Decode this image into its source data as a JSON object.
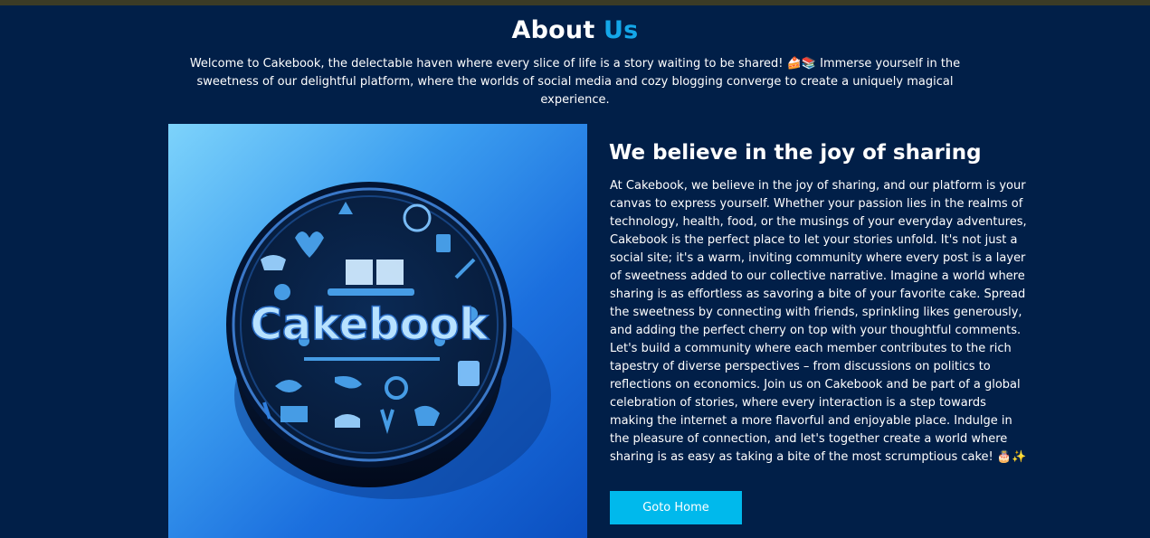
{
  "header": {
    "title_part1": "About",
    "title_part2": "Us",
    "intro": "Welcome to Cakebook, the delectable haven where every slice of life is a story waiting to be shared! 🍰📚 Immerse yourself in the sweetness of our delightful platform, where the worlds of social media and cozy blogging converge to create a uniquely magical experience."
  },
  "hero": {
    "logo_text": "Cakebook"
  },
  "section": {
    "heading": "We believe in the joy of sharing",
    "body": "At Cakebook, we believe in the joy of sharing, and our platform is your canvas to express yourself. Whether your passion lies in the realms of technology, health, food, or the musings of your everyday adventures, Cakebook is the perfect place to let your stories unfold. It's not just a social site; it's a warm, inviting community where every post is a layer of sweetness added to our collective narrative. Imagine a world where sharing is as effortless as savoring a bite of your favorite cake. Spread the sweetness by connecting with friends, sprinkling likes generously, and adding the perfect cherry on top with your thoughtful comments. Let's build a community where each member contributes to the rich tapestry of diverse perspectives – from discussions on politics to reflections on economics. Join us on Cakebook and be part of a global celebration of stories, where every interaction is a step towards making the internet a more flavorful and enjoyable place. Indulge in the pleasure of connection, and let's together create a world where sharing is as easy as taking a bite of the most scrumptious cake! 🎂✨",
    "button_label": "Goto Home"
  },
  "colors": {
    "background": "#011f48",
    "accent": "#14a7e9",
    "button": "#00b9ec"
  }
}
